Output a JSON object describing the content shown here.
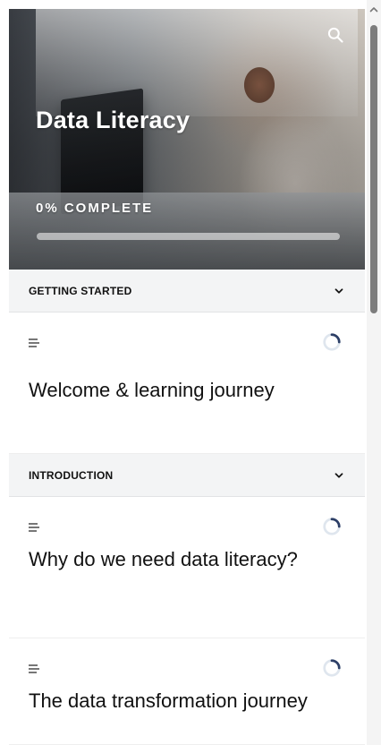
{
  "hero": {
    "title": "Data Literacy",
    "progress_text": "0% COMPLETE",
    "progress_percent": 0,
    "search_icon": "search-icon"
  },
  "sections": [
    {
      "title": "GETTING STARTED",
      "chevron_icon": "chevron-down-icon",
      "lessons": [
        {
          "title": "Welcome & learning journey",
          "type_icon": "lines-icon",
          "status_icon": "progress-spinner-icon"
        }
      ]
    },
    {
      "title": "INTRODUCTION",
      "chevron_icon": "chevron-down-icon",
      "lessons": [
        {
          "title": "Why do we need data literacy?",
          "type_icon": "lines-icon",
          "status_icon": "progress-spinner-icon"
        },
        {
          "title": "The data transformation journey",
          "type_icon": "lines-icon",
          "status_icon": "progress-spinner-icon"
        }
      ]
    }
  ],
  "colors": {
    "section_bg": "#f3f4f5",
    "text_dark": "#111111",
    "scroll_thumb": "#7d7d7d"
  }
}
